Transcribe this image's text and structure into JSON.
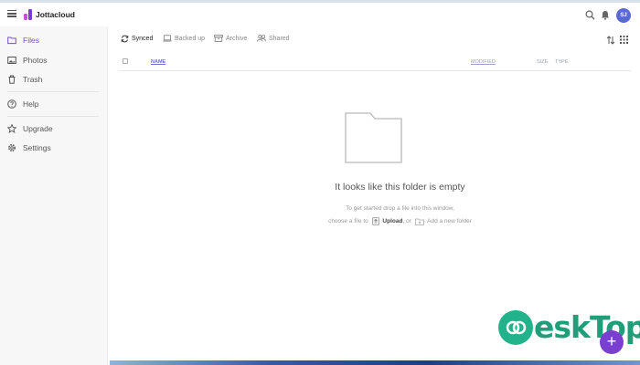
{
  "app": {
    "brand": "Jottacloud",
    "avatar_initials": "SJ",
    "accent": "#7a4dcf"
  },
  "sidebar": {
    "items": [
      {
        "label": "Files",
        "icon": "folder-icon",
        "active": true
      },
      {
        "label": "Photos",
        "icon": "photo-icon"
      },
      {
        "label": "Trash",
        "icon": "trash-icon"
      },
      {
        "label": "Help",
        "icon": "help-icon"
      },
      {
        "label": "Upgrade",
        "icon": "star-icon"
      },
      {
        "label": "Settings",
        "icon": "gear-icon"
      }
    ]
  },
  "tabs": [
    {
      "label": "Synced",
      "icon": "sync-icon",
      "active": true
    },
    {
      "label": "Backed up",
      "icon": "laptop-icon"
    },
    {
      "label": "Archive",
      "icon": "archive-icon"
    },
    {
      "label": "Shared",
      "icon": "shared-icon"
    }
  ],
  "columns": {
    "name": "NAME",
    "modified": "MODIFIED",
    "size": "SIZE",
    "type": "TYPE"
  },
  "empty": {
    "title": "It looks like this folder is empty",
    "line1": "To get started drop a file into this window,",
    "line2_prefix": "choose a file to",
    "upload": "Upload",
    "or": ", or",
    "new_folder": "Add a new folder"
  },
  "fab": {
    "label": "+"
  },
  "watermark": {
    "text": "eskTop"
  }
}
